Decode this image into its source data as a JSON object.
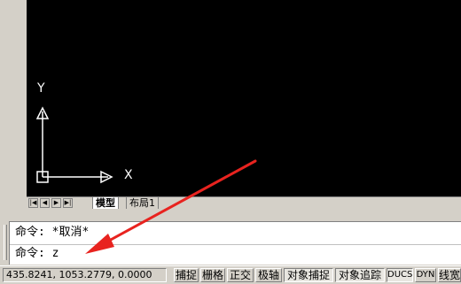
{
  "canvas": {
    "axis_x": "X",
    "axis_y": "Y"
  },
  "layout_tabs": {
    "nav": [
      "|◀",
      "◀",
      "▶",
      "▶|"
    ],
    "tabs": [
      {
        "label": "模型",
        "active": true
      },
      {
        "label": "布局1",
        "active": false
      }
    ]
  },
  "command_line": {
    "history": "命令: *取消*",
    "prompt": "命令: z"
  },
  "status_bar": {
    "coordinates": "435.8241, 1053.2779, 0.0000",
    "buttons": [
      {
        "label": "捕捉",
        "on": false
      },
      {
        "label": "栅格",
        "on": false
      },
      {
        "label": "正交",
        "on": false
      },
      {
        "label": "极轴",
        "on": false
      },
      {
        "label": "对象捕捉",
        "on": true
      },
      {
        "label": "对象追踪",
        "on": true
      },
      {
        "label": "DUCS",
        "on": true
      },
      {
        "label": "DYN",
        "on": false
      },
      {
        "label": "线宽",
        "on": false
      }
    ]
  },
  "annotation_color": "#e8231f"
}
